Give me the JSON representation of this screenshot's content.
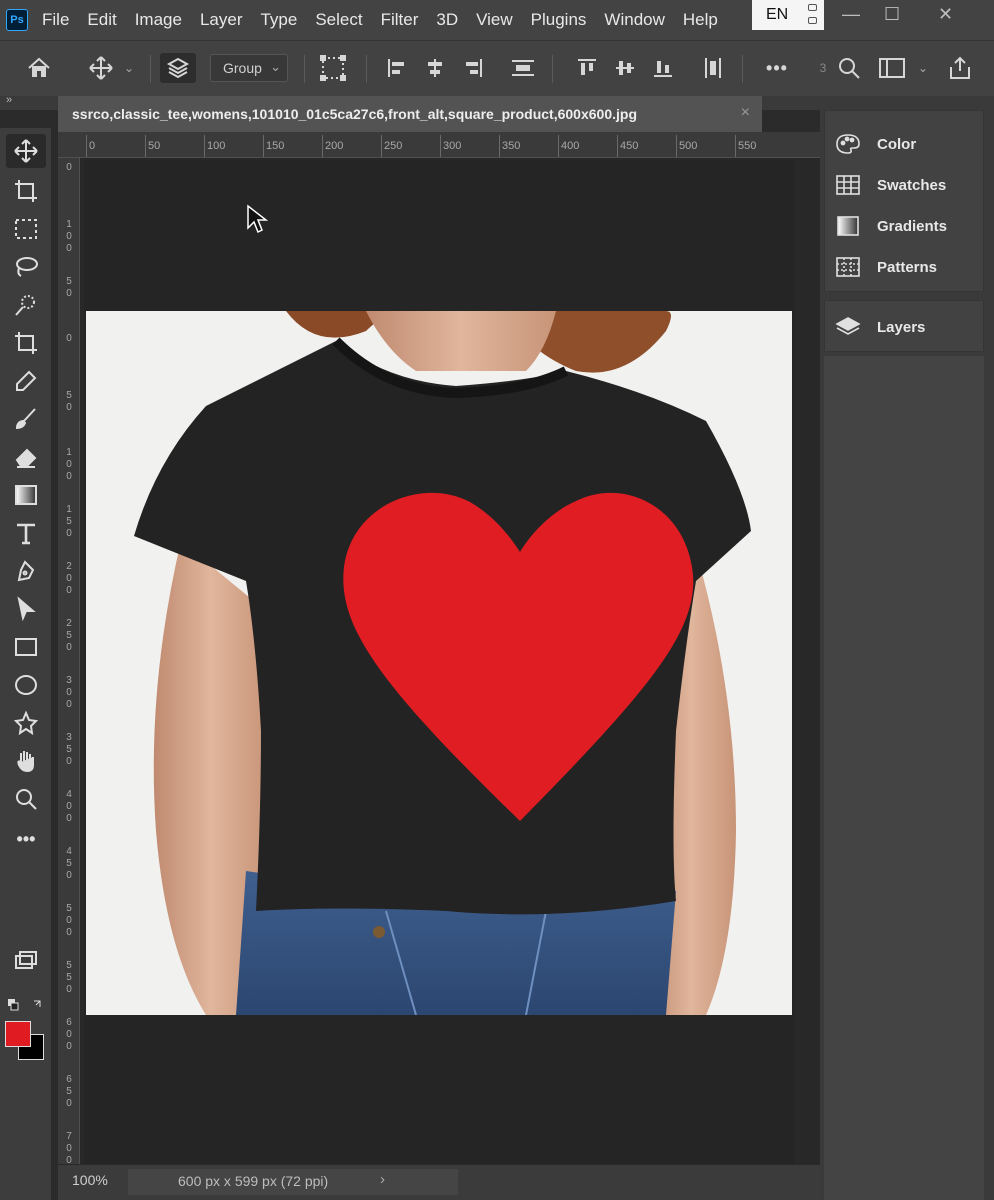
{
  "app": {
    "logo_text": "Ps",
    "menu": [
      "File",
      "Edit",
      "Image",
      "Layer",
      "Type",
      "Select",
      "Filter",
      "3D",
      "View",
      "Plugins",
      "Window",
      "Help"
    ],
    "language": "EN",
    "window_controls": {
      "minimize": "—",
      "maximize": "☐",
      "close": "✕"
    }
  },
  "options_bar": {
    "home_icon": "home-icon",
    "move_icon": "move-icon",
    "auto_select_label": "Group",
    "more_label": "•••",
    "extra_number": "3"
  },
  "document": {
    "tab_title": "ssrco,classic_tee,womens,101010_01c5ca27c6,front_alt,square_product,600x600.jpg",
    "close_glyph": "×",
    "ruler_top_labels": [
      "0",
      "50",
      "100",
      "150",
      "200",
      "250",
      "300",
      "350",
      "400",
      "450",
      "500",
      "550"
    ],
    "ruler_left_labels": [
      "0",
      "100",
      "50",
      "0",
      "50",
      "100",
      "150",
      "200",
      "250",
      "300",
      "350",
      "400",
      "450",
      "500",
      "550",
      "600",
      "650",
      "700"
    ]
  },
  "panels": {
    "items": [
      {
        "label": "Color",
        "icon": "palette-icon"
      },
      {
        "label": "Swatches",
        "icon": "swatches-grid-icon"
      },
      {
        "label": "Gradients",
        "icon": "gradient-icon"
      },
      {
        "label": "Patterns",
        "icon": "patterns-icon"
      }
    ],
    "layers_label": "Layers"
  },
  "tools": [
    "move",
    "artboard",
    "marquee",
    "lasso",
    "quick-select",
    "crop",
    "eyedropper",
    "brush",
    "eraser",
    "gradient",
    "type",
    "pen",
    "path-select",
    "rectangle",
    "ellipse",
    "custom-shape",
    "hand",
    "zoom",
    "more"
  ],
  "colors": {
    "foreground": "#e11b22",
    "background": "#000000",
    "accent": "#31a8ff"
  },
  "status": {
    "zoom": "100%",
    "doc_info": "600 px x 599 px (72 ppi)",
    "arrow": "›"
  }
}
